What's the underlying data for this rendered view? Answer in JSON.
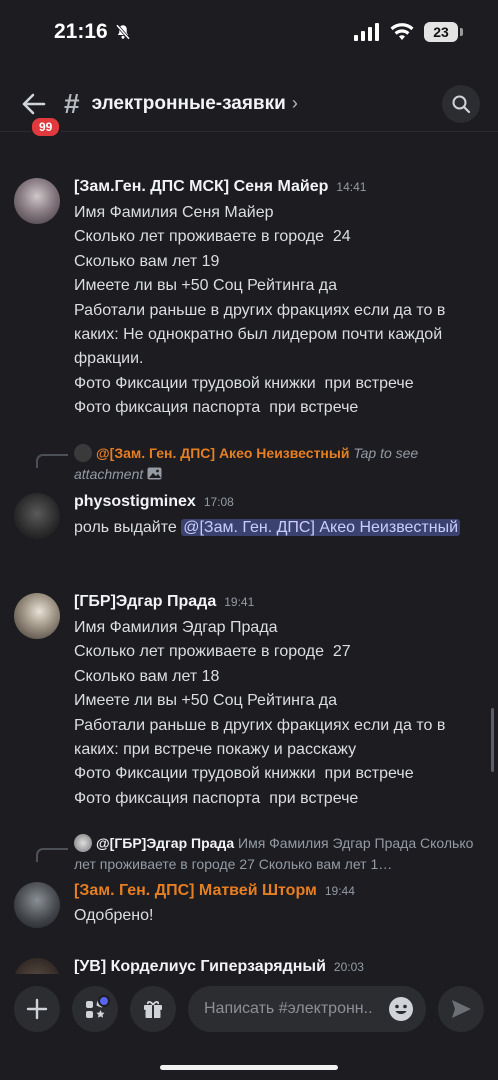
{
  "status": {
    "time": "21:16",
    "battery": "23"
  },
  "header": {
    "badge": "99",
    "channel": "электронные-заявки"
  },
  "messages": [
    {
      "author": "[Зам.Ген. ДПС МСК] Сеня Майер",
      "time": "14:41",
      "lines": "Имя Фамилия Сеня Майер\nСколько лет проживаете в городе  24\nСколько вам лет 19\nИмеете ли вы +50 Соц Рейтинга да\nРаботали раньше в других фракциях если да то в каких: Не однократно был лидером почти каждой фракции.\nФото Фиксации трудовой книжки  при встрече\nФото фиксация паспорта  при встрече"
    },
    {
      "reply_name": "@[Зам. Ген. ДПС] Акео Неизвестный",
      "reply_text": "Tap to see attachment",
      "author": "physostigminex",
      "time": "17:08",
      "text": "роль выдайте ",
      "mention": "@[Зам. Ген. ДПС] Акео Неизвестный"
    },
    {
      "author": "[ГБР]Эдгар Прада",
      "time": "19:41",
      "lines": "Имя Фамилия Эдгар Прада\nСколько лет проживаете в городе  27\nСколько вам лет 18\nИмеете ли вы +50 Соц Рейтинга да\nРаботали раньше в других фракциях если да то в каких: при встрече покажу и расскажу\nФото Фиксации трудовой книжки  при встрече\nФото фиксация паспорта  при встрече"
    },
    {
      "reply_name": "@[ГБР]Эдгар Прада",
      "reply_text": "Имя Фамилия Эдгар Прада Сколько лет проживаете в городе  27 Сколько вам лет 1…",
      "author": "[Зам. Ген. ДПС] Матвей Шторм",
      "time": "19:44",
      "text": "Одобрено!"
    },
    {
      "author": "[УВ] Корделиус Гиперзарядный",
      "time": "20:03"
    }
  ],
  "composer": {
    "placeholder": "Написать #электронн.."
  },
  "colors": {
    "orange_role": "#e67e22",
    "default_name": "#f2f3f5",
    "mention_bg": "#3c4270",
    "badge": "#e0393e"
  }
}
